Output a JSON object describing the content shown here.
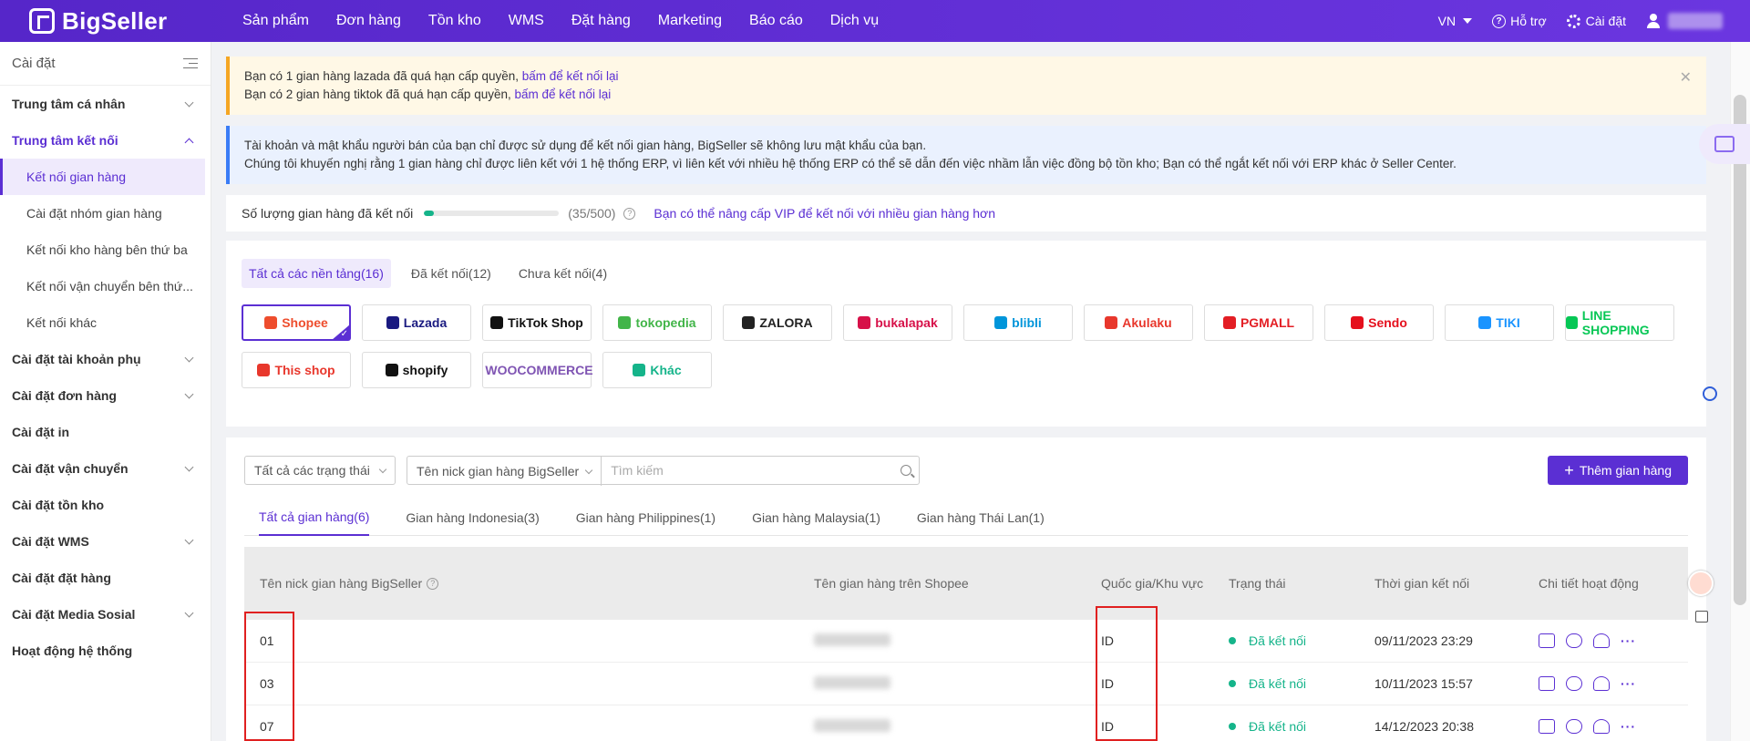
{
  "topnav": {
    "logo": "BigSeller",
    "menu": [
      "Sản phẩm",
      "Đơn hàng",
      "Tồn kho",
      "WMS",
      "Đặt hàng",
      "Marketing",
      "Báo cáo",
      "Dịch vụ"
    ],
    "lang": "VN",
    "support": "Hỗ trợ",
    "settings": "Cài đặt"
  },
  "sidebar": {
    "title": "Cài đặt",
    "items": [
      {
        "label": "Trung tâm cá nhân"
      },
      {
        "label": "Trung tâm kết nối"
      },
      {
        "label": "Cài đặt tài khoản phụ"
      },
      {
        "label": "Cài đặt đơn hàng"
      },
      {
        "label": "Cài đặt in"
      },
      {
        "label": "Cài đặt vận chuyển"
      },
      {
        "label": "Cài đặt tồn kho"
      },
      {
        "label": "Cài đặt WMS"
      },
      {
        "label": "Cài đặt đặt hàng"
      },
      {
        "label": "Cài đặt Media Sosial"
      },
      {
        "label": "Hoạt động hệ thống"
      }
    ],
    "sub": [
      "Kết nối gian hàng",
      "Cài đặt nhóm gian hàng",
      "Kết nối kho hàng bên thứ ba",
      "Kết nối vận chuyển bên thứ...",
      "Kết nối khác"
    ]
  },
  "alerts": {
    "yellow1_text": "Bạn có 1 gian hàng lazada đã quá hạn cấp quyền, ",
    "yellow1_link": "bấm để kết nối lại",
    "yellow2_text": "Bạn có 2 gian hàng tiktok đã quá hạn cấp quyền, ",
    "yellow2_link": "bấm để kết nối lại",
    "blue1": "Tài khoản và mật khẩu người bán của bạn chỉ được sử dụng để kết nối gian hàng, BigSeller sẽ không lưu mật khẩu của bạn.",
    "blue2": "Chúng tôi khuyến nghị rằng 1 gian hàng chỉ được liên kết với 1 hệ thống ERP, vì liên kết với nhiều hệ thống ERP có thể sẽ dẫn đến việc nhầm lẫn việc đồng bộ tồn kho; Bạn có thể ngắt kết nối với ERP khác ở Seller Center."
  },
  "quota": {
    "label": "Số lượng gian hàng đã kết nối",
    "count": "(35/500)",
    "fill": 0.07,
    "vip_link": "Bạn có thể nâng cấp VIP để kết nối với nhiều gian hàng hơn"
  },
  "platform_tabs": [
    "Tất cả các nền tảng(16)",
    "Đã kết nối(12)",
    "Chưa kết nối(4)"
  ],
  "platforms": [
    {
      "label": "Shopee",
      "color": "#ee4d2d"
    },
    {
      "label": "Lazada",
      "color": "#1a1a80"
    },
    {
      "label": "TikTok Shop",
      "color": "#111111"
    },
    {
      "label": "tokopedia",
      "color": "#42b549"
    },
    {
      "label": "ZALORA",
      "color": "#222222"
    },
    {
      "label": "bukalapak",
      "color": "#d71149"
    },
    {
      "label": "blibli",
      "color": "#0095da"
    },
    {
      "label": "Akulaku",
      "color": "#e8372c"
    },
    {
      "label": "PGMALL",
      "color": "#e31e24"
    },
    {
      "label": "Sendo",
      "color": "#e5101d"
    },
    {
      "label": "TIKI",
      "color": "#1a94ff"
    },
    {
      "label": "LINE SHOPPING",
      "color": "#06c755"
    },
    {
      "label": "This shop",
      "color": "#e8372c"
    },
    {
      "label": "shopify",
      "color": "#111111"
    },
    {
      "label": "WOOCOMMERCE",
      "color": "#7f54b3"
    },
    {
      "label": "Khác",
      "color": "#15b48a"
    }
  ],
  "filters": {
    "status": "Tất cả các trạng thái",
    "field": "Tên nick gian hàng BigSeller",
    "search_placeholder": "Tìm kiếm",
    "add_button": "Thêm gian hàng"
  },
  "shop_tabs": [
    "Tất cả gian hàng(6)",
    "Gian hàng Indonesia(3)",
    "Gian hàng Philippines(1)",
    "Gian hàng Malaysia(1)",
    "Gian hàng Thái Lan(1)"
  ],
  "table": {
    "headers": [
      "Tên nick gian hàng BigSeller",
      "Tên gian hàng trên Shopee",
      "Quốc gia/Khu vực",
      "Trạng thái",
      "Thời gian kết nối",
      "Chi tiết hoạt động"
    ],
    "rows": [
      {
        "nick": "01",
        "country": "ID",
        "status": "Đã kết nối",
        "time": "09/11/2023 23:29"
      },
      {
        "nick": "03",
        "country": "ID",
        "status": "Đã kết nối",
        "time": "10/11/2023 15:57"
      },
      {
        "nick": "07",
        "country": "ID",
        "status": "Đã kết nối",
        "time": "14/12/2023 20:38"
      }
    ]
  }
}
